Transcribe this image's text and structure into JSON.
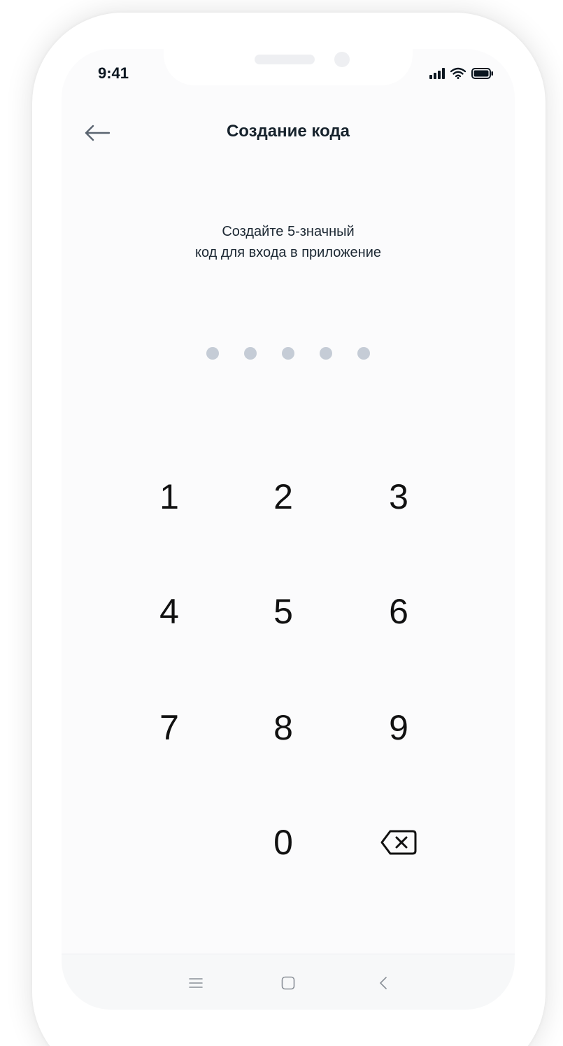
{
  "status_bar": {
    "time": "9:41",
    "icons": [
      "signal-icon",
      "wifi-icon",
      "battery-icon"
    ]
  },
  "header": {
    "title": "Создание кода",
    "back_icon": "arrow-left-icon"
  },
  "prompt": {
    "line1": "Создайте 5-значный",
    "line2": "код для входа в приложение"
  },
  "code": {
    "length": 5,
    "filled": 0
  },
  "keypad": {
    "keys": [
      "1",
      "2",
      "3",
      "4",
      "5",
      "6",
      "7",
      "8",
      "9",
      "0"
    ],
    "delete_icon": "backspace-icon"
  },
  "nav_bar": {
    "icons": [
      "menu-icon",
      "home-square-icon",
      "back-chevron-icon"
    ]
  },
  "colors": {
    "dot_empty": "#c5ccd6",
    "text_dark": "#16222c",
    "screen_bg": "#fbfbfc"
  }
}
